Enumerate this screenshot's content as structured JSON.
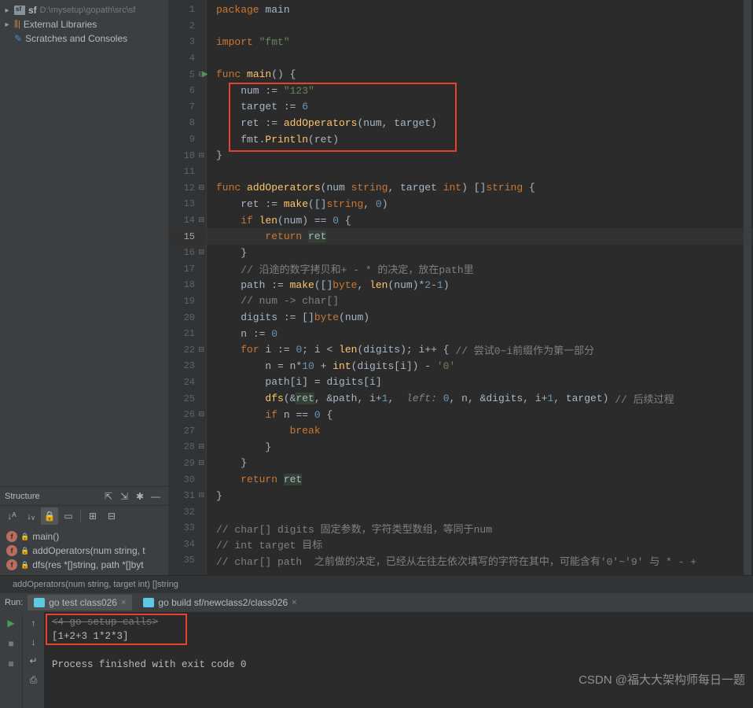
{
  "project": {
    "root_name": "sf",
    "root_path": "D:\\mysetup\\gopath\\src\\sf",
    "libs_label": "External Libraries",
    "scratches_label": "Scratches and Consoles"
  },
  "structure": {
    "title": "Structure",
    "items": [
      {
        "name": "main()"
      },
      {
        "name": "addOperators(num string, t"
      },
      {
        "name": "dfs(res *[]string, path *[]byt"
      }
    ]
  },
  "editor": {
    "breadcrumb": "addOperators(num string, target int) []string",
    "lines": [
      {
        "n": 1,
        "tokens": [
          {
            "c": "kw",
            "t": "package"
          },
          {
            "c": "id",
            "t": " "
          },
          {
            "c": "pkg",
            "t": "main"
          }
        ]
      },
      {
        "n": 2,
        "tokens": []
      },
      {
        "n": 3,
        "tokens": [
          {
            "c": "kw",
            "t": "import"
          },
          {
            "c": "id",
            "t": " "
          },
          {
            "c": "str",
            "t": "\"fmt\""
          }
        ]
      },
      {
        "n": 4,
        "tokens": []
      },
      {
        "n": 5,
        "tokens": [
          {
            "c": "kw",
            "t": "func"
          },
          {
            "c": "id",
            "t": " "
          },
          {
            "c": "fn",
            "t": "main"
          },
          {
            "c": "id",
            "t": "() {"
          }
        ],
        "run": true,
        "fold": "-"
      },
      {
        "n": 6,
        "tokens": [
          {
            "c": "id",
            "t": "    num "
          },
          {
            "c": "op",
            "t": ":= "
          },
          {
            "c": "str",
            "t": "\"123\""
          }
        ]
      },
      {
        "n": 7,
        "tokens": [
          {
            "c": "id",
            "t": "    target "
          },
          {
            "c": "op",
            "t": ":= "
          },
          {
            "c": "num",
            "t": "6"
          }
        ]
      },
      {
        "n": 8,
        "tokens": [
          {
            "c": "id",
            "t": "    ret "
          },
          {
            "c": "op",
            "t": ":= "
          },
          {
            "c": "fn",
            "t": "addOperators"
          },
          {
            "c": "id",
            "t": "(num"
          },
          {
            "c": "op",
            "t": ", "
          },
          {
            "c": "id",
            "t": "target)"
          }
        ]
      },
      {
        "n": 9,
        "tokens": [
          {
            "c": "id",
            "t": "    fmt."
          },
          {
            "c": "fn",
            "t": "Println"
          },
          {
            "c": "id",
            "t": "(ret)"
          }
        ]
      },
      {
        "n": 10,
        "tokens": [
          {
            "c": "id",
            "t": "}"
          }
        ],
        "fold": "-"
      },
      {
        "n": 11,
        "tokens": []
      },
      {
        "n": 12,
        "tokens": [
          {
            "c": "kw",
            "t": "func"
          },
          {
            "c": "id",
            "t": " "
          },
          {
            "c": "fn",
            "t": "addOperators"
          },
          {
            "c": "id",
            "t": "(num "
          },
          {
            "c": "kw",
            "t": "string"
          },
          {
            "c": "op",
            "t": ", "
          },
          {
            "c": "id",
            "t": "target "
          },
          {
            "c": "kw",
            "t": "int"
          },
          {
            "c": "id",
            "t": ") []"
          },
          {
            "c": "kw",
            "t": "string"
          },
          {
            "c": "id",
            "t": " {"
          }
        ],
        "fold": "-"
      },
      {
        "n": 13,
        "tokens": [
          {
            "c": "id",
            "t": "    ret "
          },
          {
            "c": "op",
            "t": ":= "
          },
          {
            "c": "fn",
            "t": "make"
          },
          {
            "c": "id",
            "t": "([]"
          },
          {
            "c": "kw",
            "t": "string"
          },
          {
            "c": "op",
            "t": ", "
          },
          {
            "c": "num",
            "t": "0"
          },
          {
            "c": "id",
            "t": ")"
          }
        ]
      },
      {
        "n": 14,
        "tokens": [
          {
            "c": "id",
            "t": "    "
          },
          {
            "c": "kw",
            "t": "if"
          },
          {
            "c": "id",
            "t": " "
          },
          {
            "c": "fn",
            "t": "len"
          },
          {
            "c": "id",
            "t": "(num) "
          },
          {
            "c": "op",
            "t": "== "
          },
          {
            "c": "num",
            "t": "0"
          },
          {
            "c": "id",
            "t": " {"
          }
        ],
        "fold": "-"
      },
      {
        "n": 15,
        "tokens": [
          {
            "c": "id",
            "t": "        "
          },
          {
            "c": "kw",
            "t": "return"
          },
          {
            "c": "id",
            "t": " "
          },
          {
            "c": "hl",
            "t": "ret"
          }
        ],
        "current": true
      },
      {
        "n": 16,
        "tokens": [
          {
            "c": "id",
            "t": "    }"
          }
        ],
        "fold": "-"
      },
      {
        "n": 17,
        "tokens": [
          {
            "c": "id",
            "t": "    "
          },
          {
            "c": "cm",
            "t": "// 沿途的数字拷贝和+ - * 的决定，放在path里"
          }
        ]
      },
      {
        "n": 18,
        "tokens": [
          {
            "c": "id",
            "t": "    path "
          },
          {
            "c": "op",
            "t": ":= "
          },
          {
            "c": "fn",
            "t": "make"
          },
          {
            "c": "id",
            "t": "([]"
          },
          {
            "c": "kw",
            "t": "byte"
          },
          {
            "c": "op",
            "t": ", "
          },
          {
            "c": "fn",
            "t": "len"
          },
          {
            "c": "id",
            "t": "(num)*"
          },
          {
            "c": "num",
            "t": "2"
          },
          {
            "c": "id",
            "t": "-"
          },
          {
            "c": "num",
            "t": "1"
          },
          {
            "c": "id",
            "t": ")"
          }
        ]
      },
      {
        "n": 19,
        "tokens": [
          {
            "c": "id",
            "t": "    "
          },
          {
            "c": "cm",
            "t": "// num -> char[]"
          }
        ]
      },
      {
        "n": 20,
        "tokens": [
          {
            "c": "id",
            "t": "    digits "
          },
          {
            "c": "op",
            "t": ":= "
          },
          {
            "c": "id",
            "t": "[]"
          },
          {
            "c": "kw",
            "t": "byte"
          },
          {
            "c": "id",
            "t": "(num)"
          }
        ]
      },
      {
        "n": 21,
        "tokens": [
          {
            "c": "id",
            "t": "    n "
          },
          {
            "c": "op",
            "t": ":= "
          },
          {
            "c": "num",
            "t": "0"
          }
        ]
      },
      {
        "n": 22,
        "tokens": [
          {
            "c": "id",
            "t": "    "
          },
          {
            "c": "kw",
            "t": "for"
          },
          {
            "c": "id",
            "t": " i "
          },
          {
            "c": "op",
            "t": ":= "
          },
          {
            "c": "num",
            "t": "0"
          },
          {
            "c": "op",
            "t": "; "
          },
          {
            "c": "id",
            "t": "i "
          },
          {
            "c": "op",
            "t": "< "
          },
          {
            "c": "fn",
            "t": "len"
          },
          {
            "c": "id",
            "t": "(digits)"
          },
          {
            "c": "op",
            "t": "; "
          },
          {
            "c": "id",
            "t": "i"
          },
          {
            "c": "op",
            "t": "++ "
          },
          {
            "c": "id",
            "t": "{ "
          },
          {
            "c": "cm",
            "t": "// 尝试0~i前缀作为第一部分"
          }
        ],
        "fold": "-"
      },
      {
        "n": 23,
        "tokens": [
          {
            "c": "id",
            "t": "        n "
          },
          {
            "c": "op",
            "t": "= "
          },
          {
            "c": "id",
            "t": "n*"
          },
          {
            "c": "num",
            "t": "10"
          },
          {
            "c": "id",
            "t": " + "
          },
          {
            "c": "fn",
            "t": "int"
          },
          {
            "c": "id",
            "t": "(digits[i]) - "
          },
          {
            "c": "str",
            "t": "'0'"
          }
        ]
      },
      {
        "n": 24,
        "tokens": [
          {
            "c": "id",
            "t": "        path[i] "
          },
          {
            "c": "op",
            "t": "= "
          },
          {
            "c": "id",
            "t": "digits[i]"
          }
        ]
      },
      {
        "n": 25,
        "tokens": [
          {
            "c": "id",
            "t": "        "
          },
          {
            "c": "fn",
            "t": "dfs"
          },
          {
            "c": "id",
            "t": "(&"
          },
          {
            "c": "hl",
            "t": "ret"
          },
          {
            "c": "op",
            "t": ", "
          },
          {
            "c": "id",
            "t": "&path"
          },
          {
            "c": "op",
            "t": ", "
          },
          {
            "c": "id",
            "t": "i+"
          },
          {
            "c": "num",
            "t": "1"
          },
          {
            "c": "op",
            "t": ",  "
          },
          {
            "c": "param",
            "t": "left: "
          },
          {
            "c": "num",
            "t": "0"
          },
          {
            "c": "op",
            "t": ", "
          },
          {
            "c": "id",
            "t": "n"
          },
          {
            "c": "op",
            "t": ", "
          },
          {
            "c": "id",
            "t": "&digits"
          },
          {
            "c": "op",
            "t": ", "
          },
          {
            "c": "id",
            "t": "i+"
          },
          {
            "c": "num",
            "t": "1"
          },
          {
            "c": "op",
            "t": ", "
          },
          {
            "c": "id",
            "t": "target) "
          },
          {
            "c": "cm",
            "t": "// 后续过程"
          }
        ]
      },
      {
        "n": 26,
        "tokens": [
          {
            "c": "id",
            "t": "        "
          },
          {
            "c": "kw",
            "t": "if"
          },
          {
            "c": "id",
            "t": " n "
          },
          {
            "c": "op",
            "t": "== "
          },
          {
            "c": "num",
            "t": "0"
          },
          {
            "c": "id",
            "t": " {"
          }
        ],
        "fold": "-"
      },
      {
        "n": 27,
        "tokens": [
          {
            "c": "id",
            "t": "            "
          },
          {
            "c": "kw",
            "t": "break"
          }
        ]
      },
      {
        "n": 28,
        "tokens": [
          {
            "c": "id",
            "t": "        }"
          }
        ],
        "fold": "-"
      },
      {
        "n": 29,
        "tokens": [
          {
            "c": "id",
            "t": "    }"
          }
        ],
        "fold": "-"
      },
      {
        "n": 30,
        "tokens": [
          {
            "c": "id",
            "t": "    "
          },
          {
            "c": "kw",
            "t": "return"
          },
          {
            "c": "id",
            "t": " "
          },
          {
            "c": "hl",
            "t": "ret"
          }
        ]
      },
      {
        "n": 31,
        "tokens": [
          {
            "c": "id",
            "t": "}"
          }
        ],
        "fold": "-"
      },
      {
        "n": 32,
        "tokens": []
      },
      {
        "n": 33,
        "tokens": [
          {
            "c": "cm",
            "t": "// char[] digits 固定参数，字符类型数组，等同于num"
          }
        ]
      },
      {
        "n": 34,
        "tokens": [
          {
            "c": "cm",
            "t": "// int target 目标"
          }
        ]
      },
      {
        "n": 35,
        "tokens": [
          {
            "c": "cm",
            "t": "// char[] path  之前做的决定，已经从左往左依次填写的字符在其中，可能含有'0'~'9' 与 * - +"
          }
        ]
      }
    ]
  },
  "run": {
    "label": "Run:",
    "tabs": [
      {
        "label": "go test class026"
      },
      {
        "label": "go build sf/newclass2/class026"
      }
    ],
    "console": [
      "<4 go setup calls>",
      "[1+2+3 1*2*3]",
      "",
      "Process finished with exit code 0"
    ]
  },
  "watermark": "CSDN @福大大架构师每日一题"
}
